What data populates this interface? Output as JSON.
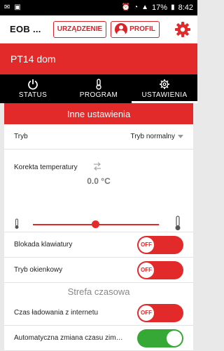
{
  "status_bar": {
    "battery": "17%",
    "time": "8:42"
  },
  "app": {
    "title": "EOB ...",
    "device_button": "URZĄDZENIE",
    "profile_button": "PROFIL"
  },
  "device_name": "PT14 dom",
  "tabs": [
    {
      "label": "STATUS",
      "icon": "power-icon",
      "active": false
    },
    {
      "label": "PROGRAM",
      "icon": "program-icon",
      "active": false
    },
    {
      "label": "USTAWIENIA",
      "icon": "gear-icon",
      "active": true
    }
  ],
  "settings": {
    "header": "Inne ustawienia",
    "tryb": {
      "label": "Tryb",
      "value": "Tryb normalny"
    },
    "korekta": {
      "label": "Korekta temperatury",
      "value": "0.0 °C",
      "slider_fraction": 0.5
    },
    "blokada": {
      "label": "Blokada klawiatury",
      "state": "OFF"
    },
    "okienkowy": {
      "label": "Tryb okienkowy",
      "state": "OFF"
    },
    "strefa_header": "Strefa czasowa",
    "czas_internet": {
      "label": "Czas ładowania z internetu",
      "state": "OFF"
    },
    "auto_czas": {
      "label": "Automatyczna zmiana czasu zim…",
      "state": "ON"
    }
  },
  "colors": {
    "accent": "#e22a2a",
    "on": "#35a835"
  }
}
